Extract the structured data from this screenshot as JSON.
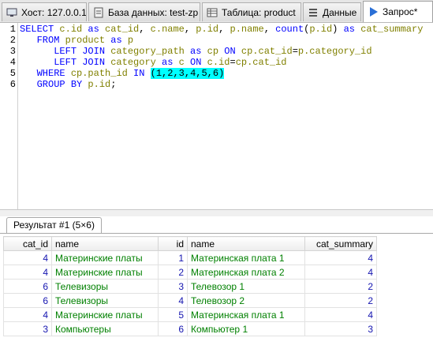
{
  "tabs": [
    {
      "label": "Хост: 127.0.0.1",
      "icon": "host-icon"
    },
    {
      "label": "База данных: test-zp",
      "icon": "database-icon"
    },
    {
      "label": "Таблица: product",
      "icon": "table-icon"
    },
    {
      "label": "Данные",
      "icon": "data-grid-icon"
    },
    {
      "label": "Запрос*",
      "icon": "play-icon"
    }
  ],
  "editor": {
    "line_numbers": [
      "1",
      "2",
      "3",
      "4",
      "5",
      "6"
    ],
    "lines": [
      [
        [
          "kw",
          "SELECT "
        ],
        [
          "id",
          "c.id"
        ],
        [
          "kw",
          " as "
        ],
        [
          "id",
          "cat_id"
        ],
        [
          "pn",
          ", "
        ],
        [
          "id",
          "c.name"
        ],
        [
          "pn",
          ", "
        ],
        [
          "id",
          "p.id"
        ],
        [
          "pn",
          ", "
        ],
        [
          "id",
          "p.name"
        ],
        [
          "pn",
          ", "
        ],
        [
          "kw",
          "count"
        ],
        [
          "pn",
          "("
        ],
        [
          "id",
          "p.id"
        ],
        [
          "pn",
          ") "
        ],
        [
          "kw",
          "as "
        ],
        [
          "id",
          "cat_summary"
        ]
      ],
      [
        [
          "pn",
          "   "
        ],
        [
          "kw",
          "FROM "
        ],
        [
          "id",
          "product"
        ],
        [
          "kw",
          " as "
        ],
        [
          "id",
          "p"
        ]
      ],
      [
        [
          "pn",
          "      "
        ],
        [
          "kw",
          "LEFT JOIN "
        ],
        [
          "id",
          "category_path"
        ],
        [
          "kw",
          " as "
        ],
        [
          "id",
          "cp"
        ],
        [
          "kw",
          " ON "
        ],
        [
          "id",
          "cp.cat_id"
        ],
        [
          "pn",
          "="
        ],
        [
          "id",
          "p.category_id"
        ]
      ],
      [
        [
          "pn",
          "      "
        ],
        [
          "kw",
          "LEFT JOIN "
        ],
        [
          "id",
          "category"
        ],
        [
          "kw",
          " as "
        ],
        [
          "id",
          "c"
        ],
        [
          "kw",
          " ON "
        ],
        [
          "id",
          "c.id"
        ],
        [
          "pn",
          "="
        ],
        [
          "id",
          "cp.cat_id"
        ]
      ],
      [
        [
          "pn",
          "   "
        ],
        [
          "kw",
          "WHERE "
        ],
        [
          "id",
          "cp.path_id"
        ],
        [
          "kw",
          " IN "
        ],
        [
          "hl",
          "(1,2,3,4,5,6)"
        ]
      ],
      [
        [
          "pn",
          "   "
        ],
        [
          "kw",
          "GROUP BY "
        ],
        [
          "id",
          "p.id"
        ],
        [
          "pn",
          ";"
        ]
      ]
    ]
  },
  "result": {
    "tab_label": "Результат #1 (5×6)",
    "columns": [
      "cat_id",
      "name",
      "id",
      "name",
      "cat_summary"
    ],
    "rows": [
      [
        "4",
        "Материнские платы",
        "1",
        "Материнская плата 1",
        "4"
      ],
      [
        "4",
        "Материнские платы",
        "2",
        "Материнская плата 2",
        "4"
      ],
      [
        "6",
        "Телевизоры",
        "3",
        "Телевозор 1",
        "2"
      ],
      [
        "6",
        "Телевизоры",
        "4",
        "Телевозор 2",
        "2"
      ],
      [
        "4",
        "Материнские платы",
        "5",
        "Материнская плата 1",
        "4"
      ],
      [
        "3",
        "Компьютеры",
        "6",
        "Компьютер 1",
        "3"
      ]
    ]
  }
}
